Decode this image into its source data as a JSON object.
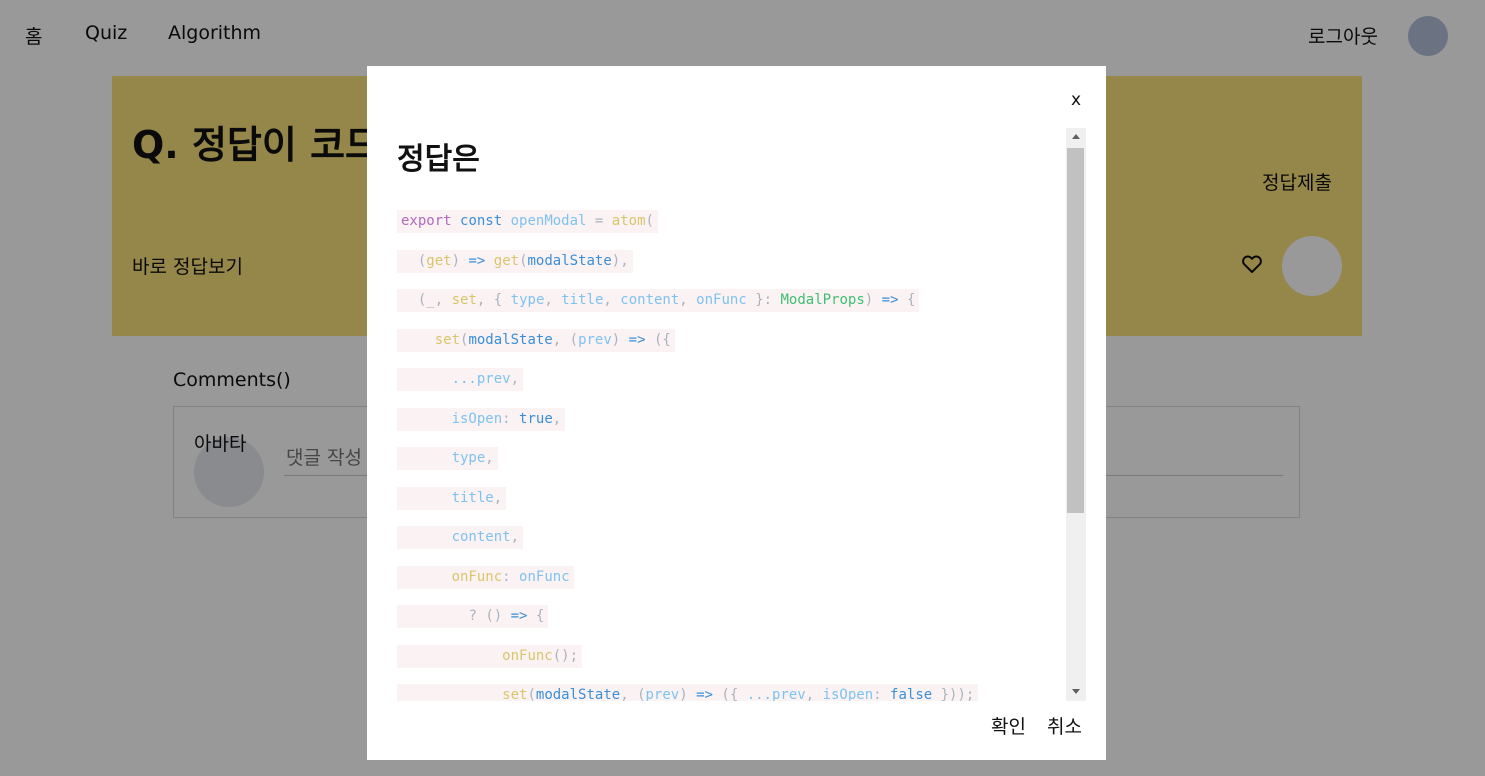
{
  "nav": {
    "home": "홈",
    "quiz": "Quiz",
    "algorithm": "Algorithm",
    "logout": "로그아웃"
  },
  "quiz": {
    "title": "Q. 정답이 코드",
    "submit_answer": "정답제출",
    "view_answer": "바로 정답보기",
    "accent_color": "#f8e27a"
  },
  "comments": {
    "label": "Comments()",
    "avatar_label": "아바타",
    "input_placeholder": "댓글 작성"
  },
  "modal": {
    "close": "x",
    "title": "정답은",
    "confirm": "확인",
    "cancel": "취소"
  },
  "code_lines": [
    "export const openModal = atom(",
    "  (get) => get(modalState),",
    "  (_, set, { type, title, content, onFunc }: ModalProps) => {",
    "    set(modalState, (prev) => ({",
    "      ...prev,",
    "      isOpen: true,",
    "      type,",
    "      title,",
    "      content,",
    "      onFunc: onFunc",
    "        ? () => {",
    "            onFunc();",
    "            set(modalState, (prev) => ({ ...prev, isOpen: false }));"
  ]
}
